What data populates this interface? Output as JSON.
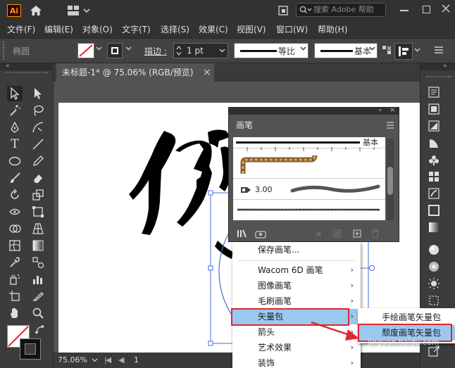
{
  "app": {
    "logo": "Ai",
    "search_placeholder": "搜索 Adobe 帮助"
  },
  "menus": [
    "文件(F)",
    "编辑(E)",
    "对象(O)",
    "文字(T)",
    "选择(S)",
    "效果(C)",
    "视图(V)",
    "窗口(W)",
    "帮助(H)"
  ],
  "control": {
    "shape_label": "椭圆",
    "stroke_label": "描边 :",
    "stroke_value": "1 pt",
    "profile_label": "等比",
    "brush_label": "基本"
  },
  "document": {
    "tab_title": "未标题-1* @ 75.06% (RGB/预览)",
    "close": "×",
    "zoom": "75.06%",
    "page": "1"
  },
  "brush_panel": {
    "title": "画笔",
    "basic_label": "基本",
    "calligraphic_size": "3.00"
  },
  "context_menu": {
    "items": [
      {
        "label": "保存画笔...",
        "submenu": false
      },
      {
        "label": "Wacom 6D 画笔",
        "submenu": true
      },
      {
        "label": "图像画笔",
        "submenu": true
      },
      {
        "label": "毛刷画笔",
        "submenu": true
      },
      {
        "label": "矢量包",
        "submenu": true
      },
      {
        "label": "箭头",
        "submenu": true
      },
      {
        "label": "艺术效果",
        "submenu": true
      },
      {
        "label": "装饰",
        "submenu": true
      }
    ],
    "arrow": "›"
  },
  "submenu": {
    "items": [
      "手绘画笔矢量包",
      "颓废画笔矢量包"
    ]
  },
  "watermark": "jingyan.baidu.com",
  "colors": {
    "highlight": "#99c9ef",
    "annotation_red": "#e0262f",
    "ai_orange": "#ff9a00"
  }
}
